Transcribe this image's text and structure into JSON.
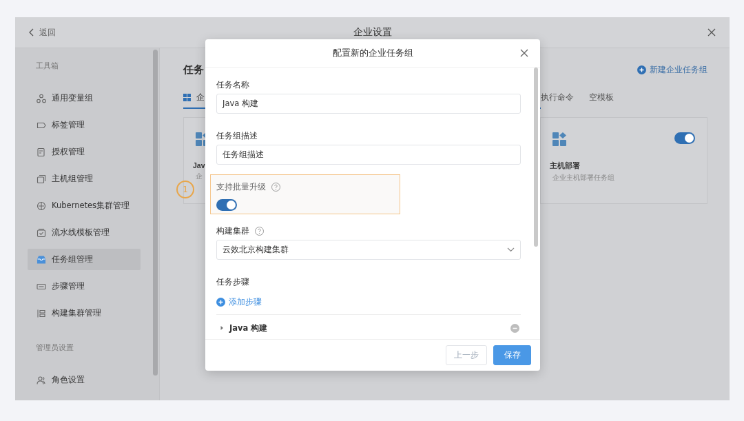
{
  "window": {
    "back": "返回",
    "title": "企业设置"
  },
  "sidebar": {
    "sections": [
      {
        "title": "工具箱",
        "items": [
          {
            "label": "通用变量组",
            "selected": false
          },
          {
            "label": "标签管理",
            "selected": false
          },
          {
            "label": "授权管理",
            "selected": false
          },
          {
            "label": "主机组管理",
            "selected": false
          },
          {
            "label": "Kubernetes集群管理",
            "selected": false
          },
          {
            "label": "流水线模板管理",
            "selected": false
          },
          {
            "label": "任务组管理",
            "selected": true
          },
          {
            "label": "步骤管理",
            "selected": false
          },
          {
            "label": "构建集群管理",
            "selected": false
          }
        ]
      },
      {
        "title": "管理员设置",
        "items": [
          {
            "label": "角色设置",
            "selected": false
          }
        ]
      }
    ]
  },
  "content": {
    "title": "任务",
    "new_button": "新建企业任务组",
    "tabs": [
      {
        "label": "企",
        "selected": true
      },
      {
        "label": "执行命令",
        "selected": false
      },
      {
        "label": "空模板",
        "selected": false
      }
    ],
    "cards": [
      {
        "title": "Jav",
        "desc": "企"
      },
      {
        "title": "主机部署",
        "desc": "企业主机部署任务组",
        "enabled": true
      }
    ],
    "step_marker": "1"
  },
  "dialog": {
    "title": "配置新的企业任务组",
    "fields": [
      {
        "kind": "input",
        "label": "任务名称",
        "value": "Java 构建"
      },
      {
        "kind": "input",
        "label": "任务组描述",
        "value": "任务组描述"
      },
      {
        "kind": "switch",
        "label": "支持批量升级",
        "help": true,
        "on": true,
        "highlighted": true
      },
      {
        "kind": "select",
        "label": "构建集群",
        "help": true,
        "value": "云效北京构建集群"
      },
      {
        "kind": "steps",
        "label": "任务步骤",
        "add_label": "添加步骤",
        "steps": [
          {
            "name": "Java 构建",
            "expanded": false
          }
        ]
      }
    ],
    "buttons": [
      {
        "label": "上一步",
        "kind": "secondary"
      },
      {
        "label": "保存",
        "kind": "primary"
      }
    ]
  }
}
